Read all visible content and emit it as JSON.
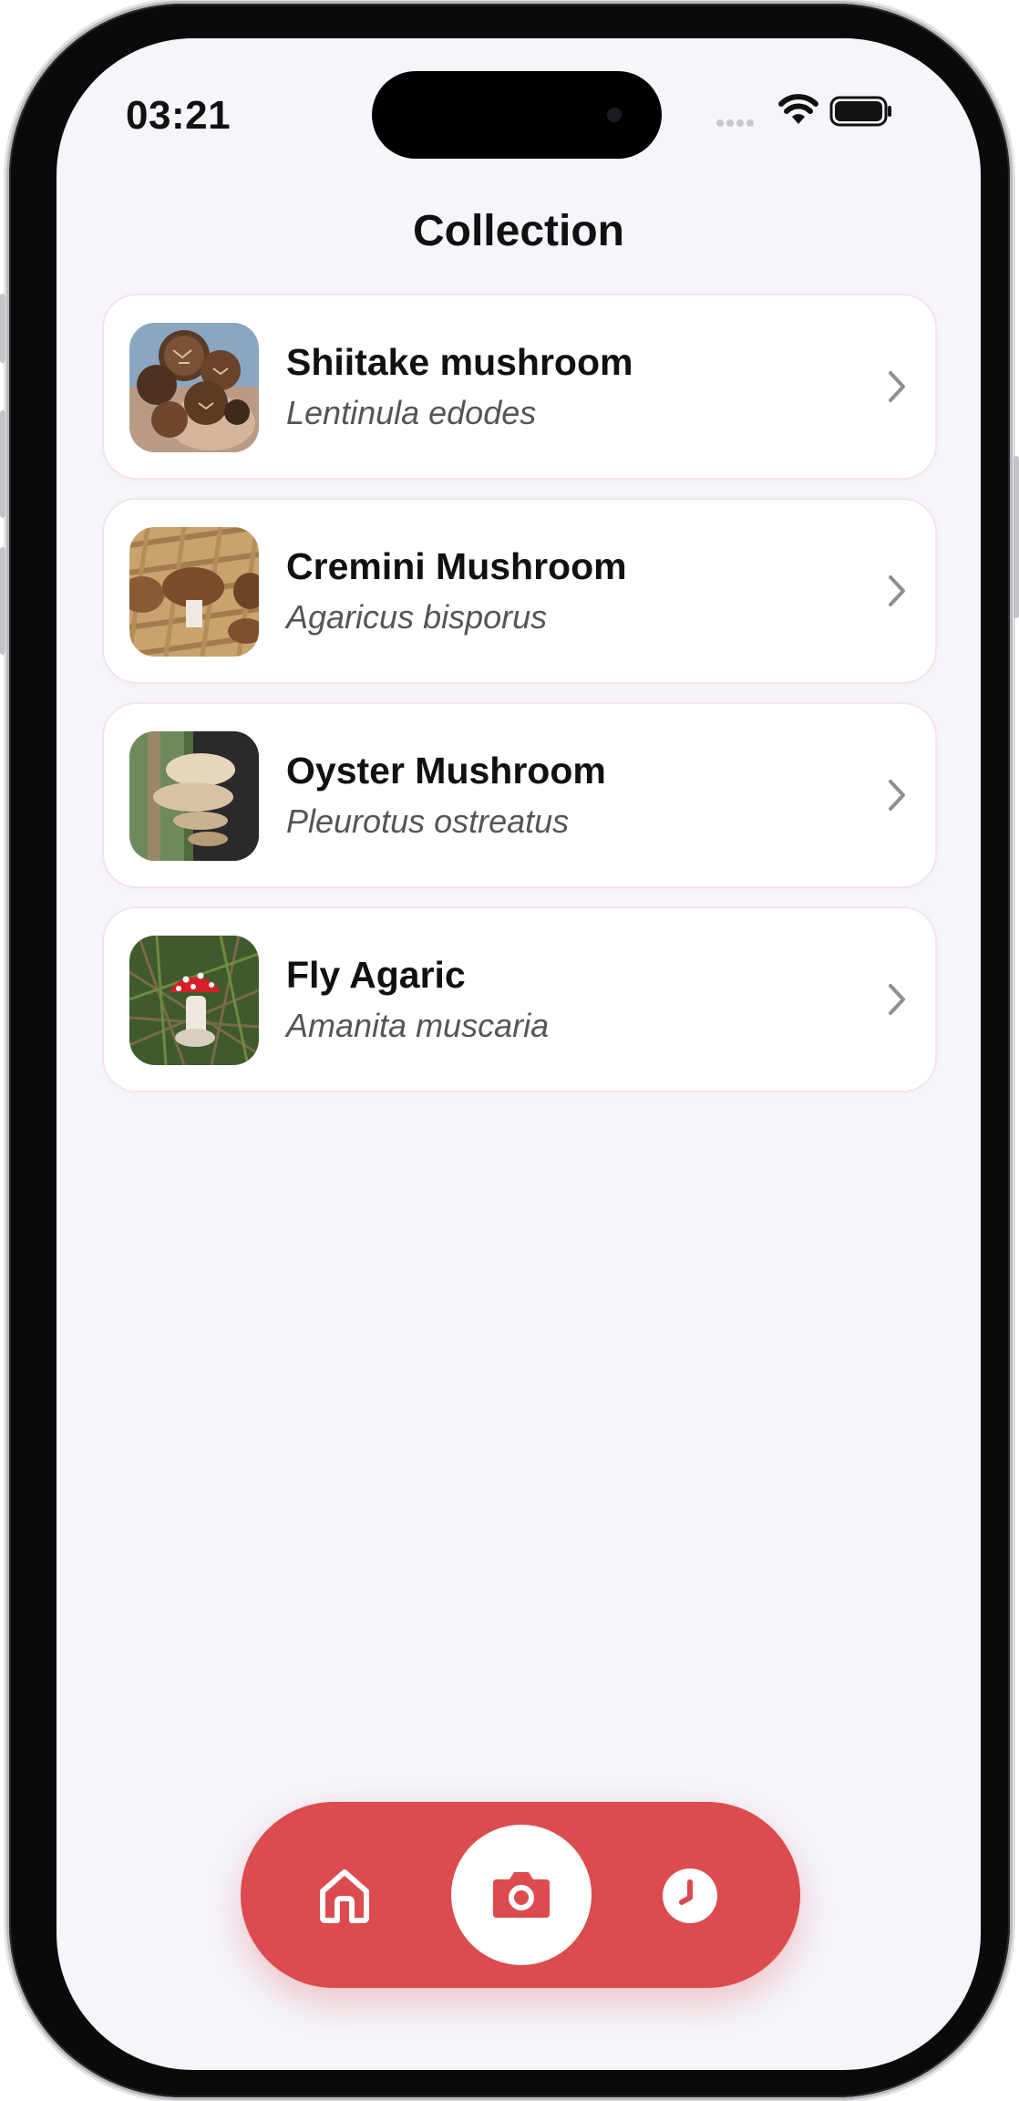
{
  "status_bar": {
    "time": "03:21"
  },
  "header": {
    "title": "Collection"
  },
  "collection": [
    {
      "name": "Shiitake mushroom",
      "scientific_name": "Lentinula edodes",
      "thumbnail_icon": "shiitake-photo"
    },
    {
      "name": "Cremini Mushroom",
      "scientific_name": "Agaricus bisporus",
      "thumbnail_icon": "cremini-photo"
    },
    {
      "name": "Oyster Mushroom",
      "scientific_name": "Pleurotus ostreatus",
      "thumbnail_icon": "oyster-photo"
    },
    {
      "name": "Fly Agaric",
      "scientific_name": "Amanita muscaria",
      "thumbnail_icon": "fly-agaric-photo"
    }
  ],
  "tab_bar": {
    "items": [
      {
        "icon": "home-icon",
        "active": false
      },
      {
        "icon": "camera-icon",
        "active": true
      },
      {
        "icon": "clock-icon",
        "active": false
      }
    ]
  },
  "colors": {
    "accent": "#dc4b4e",
    "background": "#f5f6fb",
    "card": "#ffffff",
    "card_border": "#f6e3e6"
  }
}
